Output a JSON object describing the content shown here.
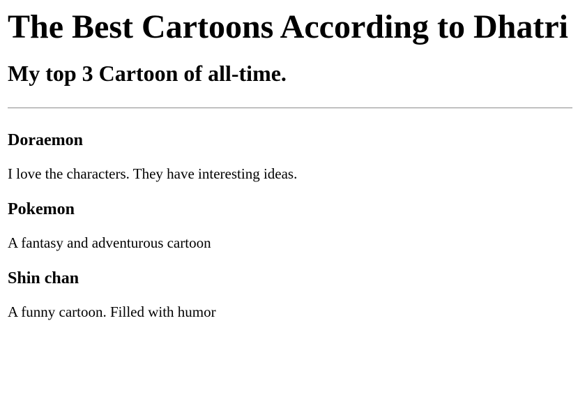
{
  "page": {
    "title": "The Best Cartoons According to Dhatri",
    "subtitle": "My top 3 Cartoon of all-time."
  },
  "cartoons": [
    {
      "name": "Doraemon",
      "description": "I love the characters. They have interesting ideas."
    },
    {
      "name": "Pokemon",
      "description": "A fantasy and adventurous cartoon"
    },
    {
      "name": "Shin chan",
      "description": "A funny cartoon. Filled with humor"
    }
  ]
}
